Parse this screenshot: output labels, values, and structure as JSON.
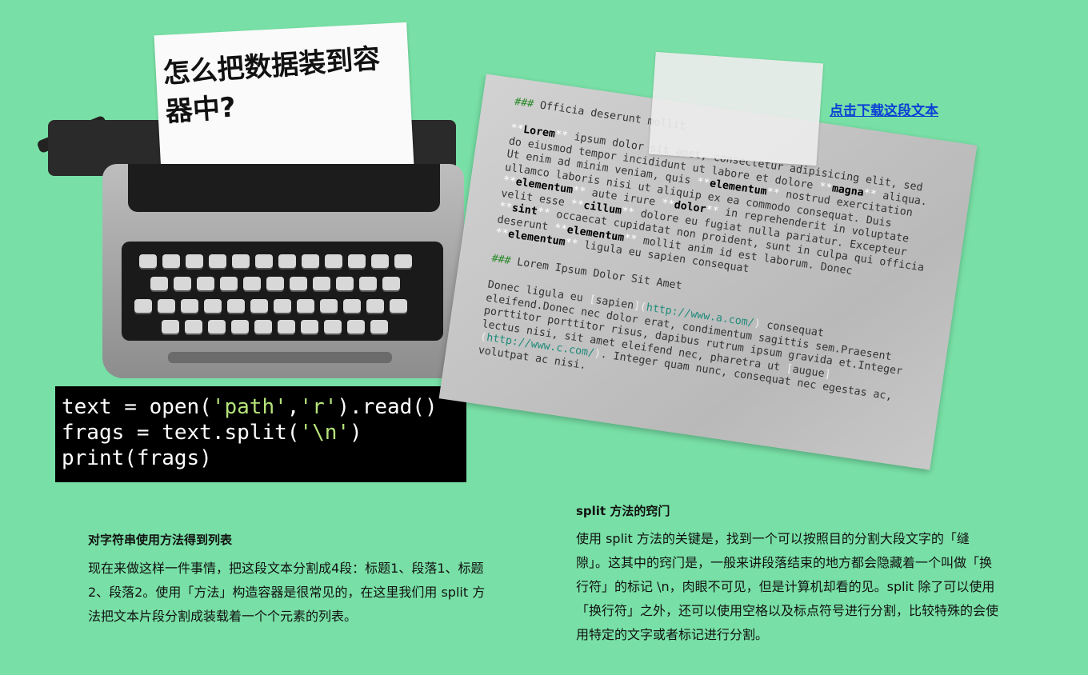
{
  "typewriter": {
    "paper_title": "怎么把数据装到容器中?"
  },
  "code": {
    "lines": [
      [
        {
          "t": "text = open("
        },
        {
          "t": "'path'",
          "s": 1
        },
        {
          "t": ","
        },
        {
          "t": "'r'",
          "s": 1
        },
        {
          "t": ").read()"
        }
      ],
      [
        {
          "t": "frags = text.split("
        },
        {
          "t": "'\\n'",
          "s": 1
        },
        {
          "t": ")"
        }
      ],
      [
        {
          "t": "print(frags)"
        }
      ]
    ]
  },
  "paper": {
    "lines": [
      "### Officia deserunt mollit",
      "",
      "**Lorem** ipsum dolor sit amet, consectetur adipisicing elit, sed",
      "do eiusmod tempor incididunt ut labore et dolore **magna** aliqua.",
      "Ut enim ad minim veniam, quis **elementum** nostrud exercitation",
      "ullamco laboris nisi ut aliquip ex ea commodo consequat. Duis",
      "**elementum** aute irure **dolor** in reprehenderit in voluptate",
      "velit esse **cillum** dolore eu fugiat nulla pariatur. Excepteur",
      "**sint** occaecat cupidatat non proident, sunt in culpa qui officia",
      "deserunt **elementum** mollit anim id est laborum. Donec",
      "**elementum** ligula eu sapien consequat",
      "",
      "### Lorem Ipsum Dolor Sit Amet",
      "",
      "Donec ligula eu [sapien](http://www.a.com/) consequat",
      "eleifend.Donec nec dolor erat, condimentum sagittis sem.Praesent",
      "porttitor porttitor risus, dapibus rutrum ipsum gravida et.Integer",
      "lectus nisi, sit amet eleifend nec, pharetra ut [augue]",
      "(http://www.c.com/). Integer quam nunc, consequat nec egestas ac,",
      "volutpat ac nisi."
    ]
  },
  "download_link": "点击下载这段文本",
  "left": {
    "heading": "对字符串使用方法得到列表",
    "body": "现在来做这样一件事情，把这段文本分割成4段：标题1、段落1、标题2、段落2。使用「方法」构造容器是很常见的，在这里我们用 split 方法把文本片段分割成装载着一个个元素的列表。"
  },
  "right": {
    "heading": "split 方法的窍门",
    "body": "使用 split 方法的关键是，找到一个可以按照目的分割大段文字的「缝隙」。这其中的窍门是，一般来讲段落结束的地方都会隐藏着一个叫做「换行符」的标记 \\n，肉眼不可见，但是计算机却看的见。split 除了可以使用「换行符」之外，还可以使用空格以及标点符号进行分割，比较特殊的会使用特定的文字或者标记进行分割。"
  },
  "colors": {
    "background": "#78e0a6",
    "link": "#0b3fd6",
    "code_string": "#b5e37a"
  }
}
